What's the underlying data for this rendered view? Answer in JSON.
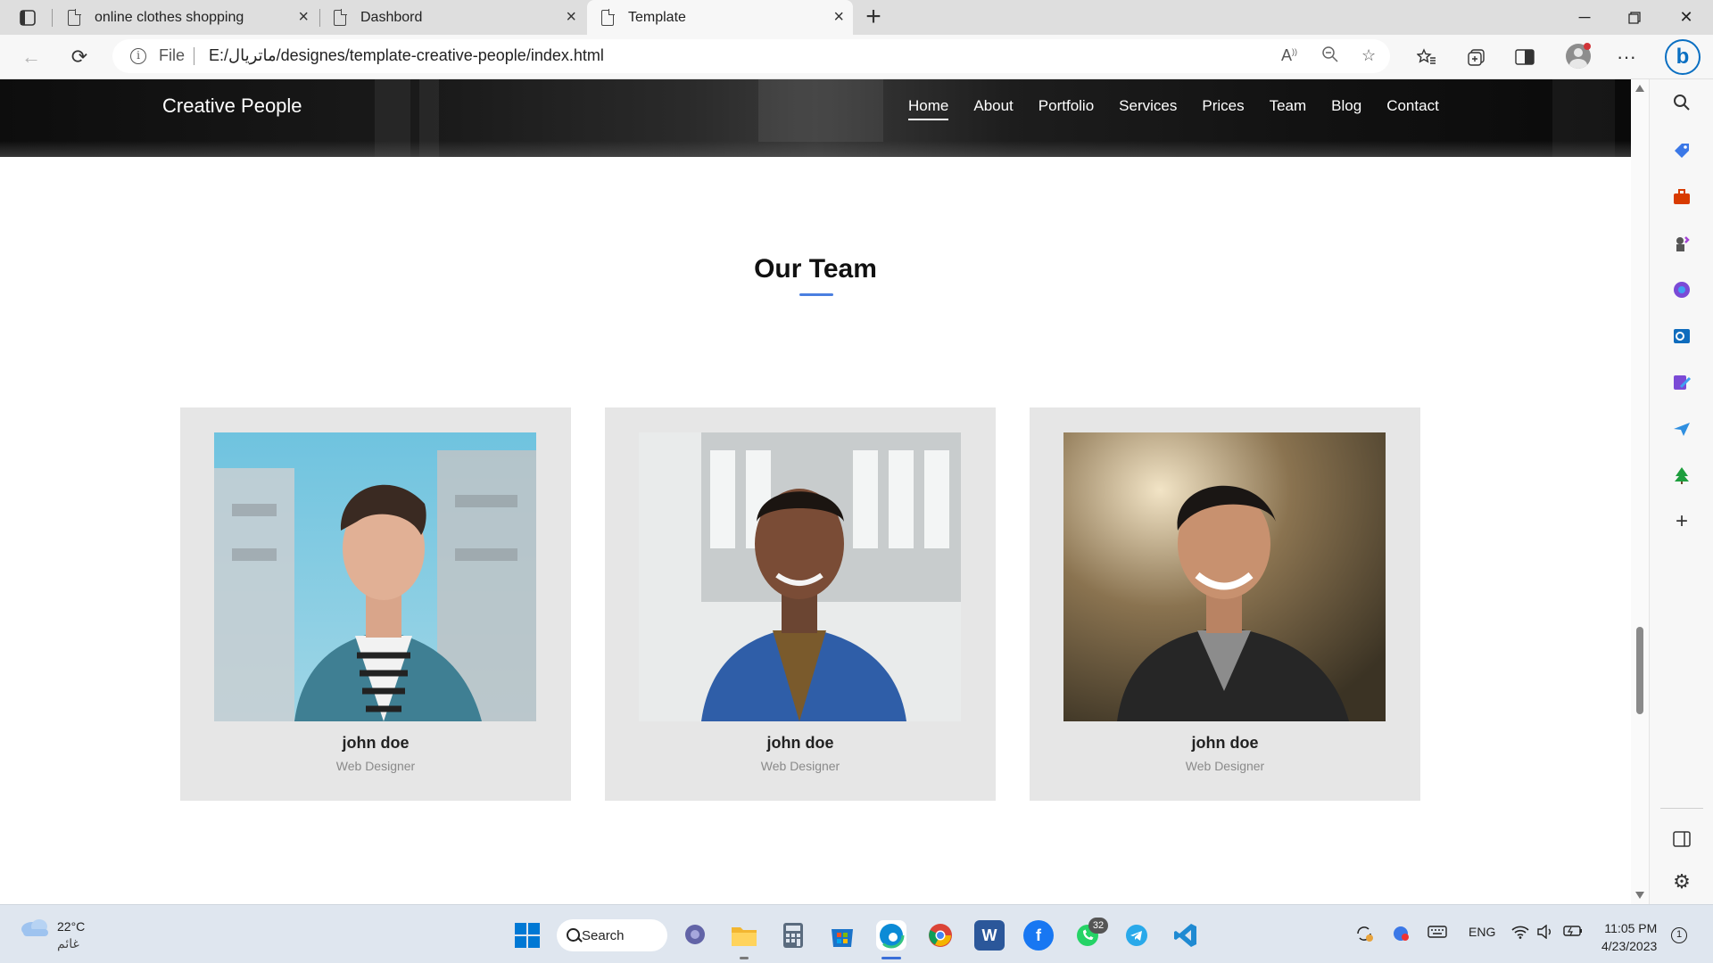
{
  "browser": {
    "tabs": [
      {
        "title": "online clothes shopping",
        "active": false
      },
      {
        "title": "Dashbord",
        "active": false
      },
      {
        "title": "Template",
        "active": true
      }
    ],
    "address": {
      "scheme_label": "File",
      "url": "E:/ماتريال/designes/template-creative-people/index.html"
    }
  },
  "site": {
    "brand": "Creative People",
    "nav": [
      "Home",
      "About",
      "Portfolio",
      "Services",
      "Prices",
      "Team",
      "Blog",
      "Contact"
    ],
    "section_title": "Our Team",
    "team": [
      {
        "name": "john doe",
        "role": "Web Designer"
      },
      {
        "name": "john doe",
        "role": "Web Designer"
      },
      {
        "name": "john doe",
        "role": "Web Designer"
      }
    ]
  },
  "taskbar": {
    "weather_temp": "22°C",
    "weather_condition": "غائم",
    "search_label": "Search",
    "whatsapp_badge": "32",
    "language": "ENG",
    "time": "11:05 PM",
    "date": "4/23/2023",
    "notification_count": "1"
  },
  "colors": {
    "accent_underline": "#4a7fe0",
    "card_bg": "#e6e6e6",
    "header_bg": "#111111"
  }
}
